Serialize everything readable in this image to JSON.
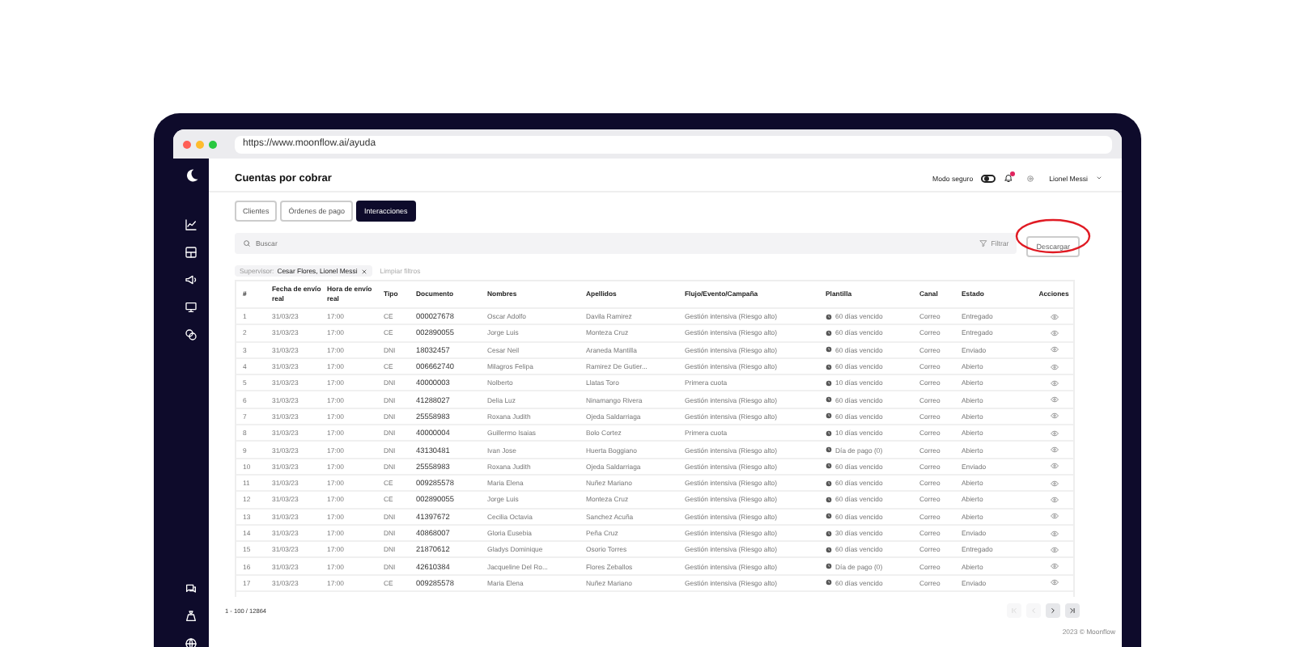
{
  "browser": {
    "url": "https://www.moonflow.ai/ayuda"
  },
  "page": {
    "title": "Cuentas por cobrar"
  },
  "header": {
    "safe_mode": {
      "label": "Modo seguro",
      "on": false
    },
    "notifications": {
      "unread": true
    },
    "user": "Lionel Messi"
  },
  "tabs": [
    {
      "label": "Clientes",
      "selected": false
    },
    {
      "label": "Órdenes de pago",
      "selected": false
    },
    {
      "label": "Interacciones",
      "selected": true
    }
  ],
  "toolbar": {
    "search": {
      "placeholder": "Buscar"
    },
    "filter_button": "Filtrar",
    "download_button": "Descargar"
  },
  "filters": {
    "label": "Supervisor:",
    "value": "Cesar Flores, Lionel Messi",
    "clear": "Limpiar filtros"
  },
  "table": {
    "columns": [
      "#",
      "Fecha de envío real",
      "Hora de envío real",
      "Tipo",
      "Documento",
      "Nombres",
      "Apellidos",
      "Flujo/Evento/Campaña",
      "Plantilla",
      "Canal",
      "Estado",
      "Acciones"
    ],
    "rows": [
      [
        "1",
        "31/03/23",
        "17:00",
        "CE",
        "000027678",
        "Oscar Adolfo",
        "Davila Ramirez",
        "Gestión intensiva (Riesgo alto)",
        "60 días vencido",
        "Correo",
        "Entregado"
      ],
      [
        "2",
        "31/03/23",
        "17:00",
        "CE",
        "002890055",
        "Jorge Luis",
        "Monteza Cruz",
        "Gestión intensiva (Riesgo alto)",
        "60 días vencido",
        "Correo",
        "Entregado"
      ],
      [
        "3",
        "31/03/23",
        "17:00",
        "DNI",
        "18032457",
        "Cesar Neil",
        "Araneda Mantilla",
        "Gestión intensiva (Riesgo alto)",
        "60 días vencido",
        "Correo",
        "Enviado"
      ],
      [
        "4",
        "31/03/23",
        "17:00",
        "CE",
        "006662740",
        "Milagros Felipa",
        "Ramirez De Gutier...",
        "Gestión intensiva (Riesgo alto)",
        "60 días vencido",
        "Correo",
        "Abierto"
      ],
      [
        "5",
        "31/03/23",
        "17:00",
        "DNI",
        "40000003",
        "Nolberto",
        "Llatas Toro",
        "Primera cuota",
        "10 días vencido",
        "Correo",
        "Abierto"
      ],
      [
        "6",
        "31/03/23",
        "17:00",
        "DNI",
        "41288027",
        "Delia Luz",
        "Ninamango Rivera",
        "Gestión intensiva (Riesgo alto)",
        "60 días vencido",
        "Correo",
        "Abierto"
      ],
      [
        "7",
        "31/03/23",
        "17:00",
        "DNI",
        "25558983",
        "Roxana Judith",
        "Ojeda Saldarriaga",
        "Gestión intensiva (Riesgo alto)",
        "60 días vencido",
        "Correo",
        "Abierto"
      ],
      [
        "8",
        "31/03/23",
        "17:00",
        "DNI",
        "40000004",
        "Guillermo Isaias",
        "Bolo Cortez",
        "Primera cuota",
        "10 días vencido",
        "Correo",
        "Abierto"
      ],
      [
        "9",
        "31/03/23",
        "17:00",
        "DNI",
        "43130481",
        "Ivan Jose",
        "Huerta Boggiano",
        "Gestión intensiva (Riesgo alto)",
        "Día de pago (0)",
        "Correo",
        "Abierto"
      ],
      [
        "10",
        "31/03/23",
        "17:00",
        "DNI",
        "25558983",
        "Roxana Judith",
        "Ojeda Saldarriaga",
        "Gestión intensiva (Riesgo alto)",
        "60 días vencido",
        "Correo",
        "Enviado"
      ],
      [
        "11",
        "31/03/23",
        "17:00",
        "CE",
        "009285578",
        "Maria Elena",
        "Nuñez Mariano",
        "Gestión intensiva (Riesgo alto)",
        "60 días vencido",
        "Correo",
        "Abierto"
      ],
      [
        "12",
        "31/03/23",
        "17:00",
        "CE",
        "002890055",
        "Jorge Luis",
        "Monteza Cruz",
        "Gestión intensiva (Riesgo alto)",
        "60 días vencido",
        "Correo",
        "Abierto"
      ],
      [
        "13",
        "31/03/23",
        "17:00",
        "DNI",
        "41397672",
        "Cecilia Octavia",
        "Sanchez Acuña",
        "Gestión intensiva (Riesgo alto)",
        "60 días vencido",
        "Correo",
        "Abierto"
      ],
      [
        "14",
        "31/03/23",
        "17:00",
        "DNI",
        "40868007",
        "Gloria Eusebia",
        "Peña Cruz",
        "Gestión intensiva (Riesgo alto)",
        "30 días vencido",
        "Correo",
        "Enviado"
      ],
      [
        "15",
        "31/03/23",
        "17:00",
        "DNI",
        "21870612",
        "Gladys Dominique",
        "Osorio Torres",
        "Gestión intensiva (Riesgo alto)",
        "60 días vencido",
        "Correo",
        "Entregado"
      ],
      [
        "16",
        "31/03/23",
        "17:00",
        "DNI",
        "42610384",
        "Jacqueline Del Ro...",
        "Flores Zeballos",
        "Gestión intensiva (Riesgo alto)",
        "Día de pago (0)",
        "Correo",
        "Abierto"
      ],
      [
        "17",
        "31/03/23",
        "17:00",
        "CE",
        "009285578",
        "Maria Elena",
        "Nuñez Mariano",
        "Gestión intensiva (Riesgo alto)",
        "60 días vencido",
        "Correo",
        "Enviado"
      ]
    ]
  },
  "pagination": {
    "range": "1 - 100 / 12864",
    "buttons": [
      {
        "kind": "first",
        "disabled": true
      },
      {
        "kind": "prev",
        "disabled": true
      },
      {
        "kind": "next",
        "disabled": false
      },
      {
        "kind": "last",
        "disabled": false
      }
    ]
  },
  "footer": "2023 © Moonflow"
}
